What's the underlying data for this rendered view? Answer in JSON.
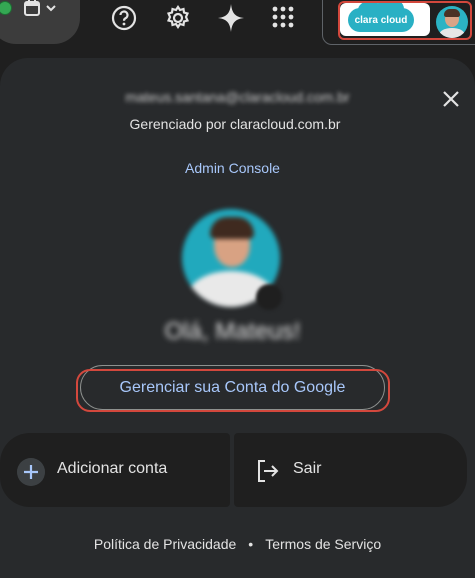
{
  "topbar": {
    "icons": [
      "status-dot",
      "calendar-icon",
      "chevron-down-icon",
      "help-icon",
      "gear-icon",
      "gemini-icon",
      "apps-grid-icon"
    ],
    "org_logo_text": "clara cloud"
  },
  "account": {
    "email": "mateus.santana@claracloud.com.br",
    "managed_by": "Gerenciado por claracloud.com.br",
    "admin_console": "Admin Console",
    "greeting": "Olá, Mateus!",
    "manage_button": "Gerenciar sua Conta do Google",
    "add_account": "Adicionar conta",
    "sign_out": "Sair"
  },
  "footer": {
    "privacy": "Política de Privacidade",
    "separator": "•",
    "terms": "Termos de Serviço"
  },
  "colors": {
    "background": "#1f1f1f",
    "panel": "#282a2c",
    "link": "#a8c7fa",
    "highlight": "#d3483d",
    "status_green": "#34a853",
    "avatar_teal": "#21a9bd"
  }
}
